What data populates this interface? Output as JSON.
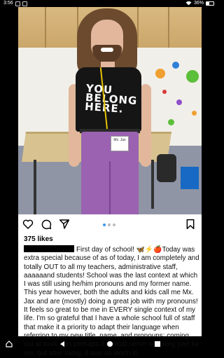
{
  "status_bar": {
    "time": "3:56",
    "battery_text": "36%",
    "icons": [
      "notification-icon",
      "calendar-icon",
      "wifi-icon",
      "battery-icon"
    ]
  },
  "photo": {
    "shirt_text_line1": "YOU",
    "shirt_text_line2": "BELONG",
    "shirt_text_line3": "HERE.",
    "badge_text": "Mx. Jax"
  },
  "actions": {
    "icons": [
      "heart-icon",
      "comment-icon",
      "share-icon",
      "bookmark-icon"
    ],
    "carousel_count": 3,
    "carousel_active": 1
  },
  "post": {
    "likes": "375 likes",
    "caption": "First day of school! 🦋⚡🍎Today was extra special because of as of today, I am completely and totally OUT to all my teachers, administrative staff, aaaaaand students! School was the last context at which I was still using he/him pronouns and my former name. This year however, both the adults and kids call me Mx. Jax and are (mostly) doing a great job with my pronouns! It feels so great to be me in EVERY single context of my life. I'm so grateful that I have a whole school full of staff that make it a priority to adapt their language when referring to my new title, name, and pronouns; coming out at work was perhaps the most nerve wracking part for me, but after today, it was so worth it!"
  },
  "nav": {
    "icons": [
      "home-icon",
      "back-icon",
      "home-circle-icon",
      "recents-icon"
    ]
  }
}
